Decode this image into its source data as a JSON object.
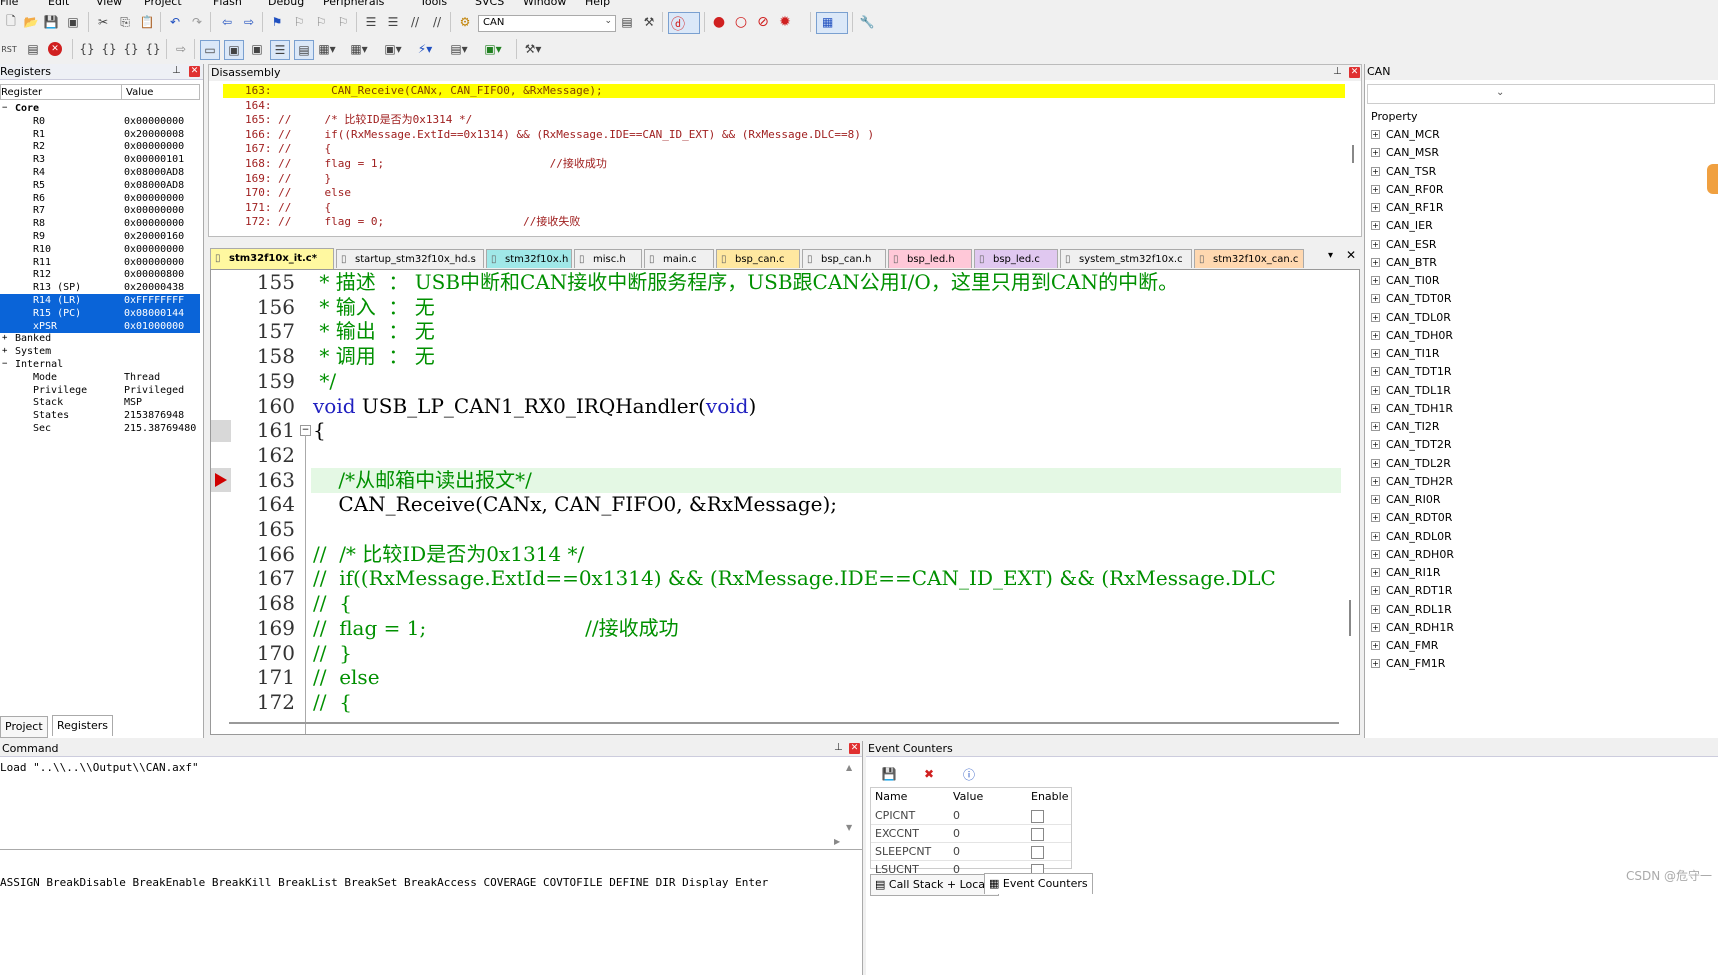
{
  "menu": [
    "File",
    "Edit",
    "View",
    "Project",
    "Flash",
    "Debug",
    "Peripherals",
    "Tools",
    "SVCS",
    "Window",
    "Help"
  ],
  "toolbar": {
    "target": "CAN"
  },
  "registers": {
    "title": "Registers",
    "col_register": "Register",
    "col_value": "Value",
    "core_label": "Core",
    "rows": [
      {
        "name": "R0",
        "value": "0x00000000"
      },
      {
        "name": "R1",
        "value": "0x20000008"
      },
      {
        "name": "R2",
        "value": "0x00000000"
      },
      {
        "name": "R3",
        "value": "0x00000101"
      },
      {
        "name": "R4",
        "value": "0x08000AD8"
      },
      {
        "name": "R5",
        "value": "0x08000AD8"
      },
      {
        "name": "R6",
        "value": "0x00000000"
      },
      {
        "name": "R7",
        "value": "0x00000000"
      },
      {
        "name": "R8",
        "value": "0x00000000"
      },
      {
        "name": "R9",
        "value": "0x20000160"
      },
      {
        "name": "R10",
        "value": "0x00000000"
      },
      {
        "name": "R11",
        "value": "0x00000000"
      },
      {
        "name": "R12",
        "value": "0x00000800"
      },
      {
        "name": "R13 (SP)",
        "value": "0x20000438"
      },
      {
        "name": "R14 (LR)",
        "value": "0xFFFFFFFF"
      },
      {
        "name": "R15 (PC)",
        "value": "0x08000144"
      },
      {
        "name": "xPSR",
        "value": "0x01000000"
      }
    ],
    "banked": "Banked",
    "system": "System",
    "internal": "Internal",
    "internal_rows": [
      {
        "name": "Mode",
        "value": "Thread"
      },
      {
        "name": "Privilege",
        "value": "Privileged"
      },
      {
        "name": "Stack",
        "value": "MSP"
      },
      {
        "name": "States",
        "value": "2153876948"
      },
      {
        "name": "Sec",
        "value": "215.38769480"
      }
    ],
    "tab_project": "Project",
    "tab_registers": "Registers"
  },
  "disassembly": {
    "title": "Disassembly",
    "lines": [
      "163:         CAN_Receive(CANx, CAN_FIFO0, &RxMessage);",
      "164: ",
      "165: //     /* 比较ID是否为0x1314 */",
      "166: //     if((RxMessage.ExtId==0x1314) && (RxMessage.IDE==CAN_ID_EXT) && (RxMessage.DLC==8) )",
      "167: //     {",
      "168: //     flag = 1;                         //接收成功",
      "169: //     }",
      "170: //     else",
      "171: //     {",
      "172: //     flag = 0;                     //接收失败"
    ]
  },
  "editor": {
    "tabs": [
      {
        "label": "stm32f10x_it.c*",
        "color": "#fff8a0"
      },
      {
        "label": "startup_stm32f10x_hd.s",
        "color": "#f0f0f0"
      },
      {
        "label": "stm32f10x.h",
        "color": "#a0e8e8"
      },
      {
        "label": "misc.h",
        "color": "#f0f0f0"
      },
      {
        "label": "main.c",
        "color": "#f0f0f0"
      },
      {
        "label": "bsp_can.c",
        "color": "#ffe8a0"
      },
      {
        "label": "bsp_can.h",
        "color": "#f0f0f0"
      },
      {
        "label": "bsp_led.h",
        "color": "#ffc8d8"
      },
      {
        "label": "bsp_led.c",
        "color": "#e0c8f0"
      },
      {
        "label": "system_stm32f10x.c",
        "color": "#f0f0f0"
      },
      {
        "label": "stm32f10x_can.c",
        "color": "#ffd8b0"
      }
    ],
    "line_numbers": [
      "155",
      "156",
      "157",
      "158",
      "159",
      "160",
      "161",
      "162",
      "163",
      "164",
      "165",
      "166",
      "167",
      "168",
      "169",
      "170",
      "171",
      "172"
    ],
    "code": [
      " * 描述  ： USB中断和CAN接收中断服务程序，USB跟CAN公用I/O，这里只用到CAN的中断。",
      " * 输入  ： 无",
      " * 输出  ： 无",
      " * 调用  ： 无",
      " */",
      "void USB_LP_CAN1_RX0_IRQHandler(void)",
      "{",
      "",
      "    /*从邮箱中读出报文*/",
      "    CAN_Receive(CANx, CAN_FIFO0, &RxMessage);",
      "",
      "//  /* 比较ID是否为0x1314 */",
      "//  if((RxMessage.ExtId==0x1314) && (RxMessage.IDE==CAN_ID_EXT) && (RxMessage.DLC",
      "//  {",
      "//  flag = 1;                         //接收成功",
      "//  }",
      "//  else",
      "//  {"
    ]
  },
  "can_panel": {
    "title": "CAN",
    "property_label": "Property",
    "items": [
      "CAN_MCR",
      "CAN_MSR",
      "CAN_TSR",
      "CAN_RF0R",
      "CAN_RF1R",
      "CAN_IER",
      "CAN_ESR",
      "CAN_BTR",
      "CAN_TI0R",
      "CAN_TDT0R",
      "CAN_TDL0R",
      "CAN_TDH0R",
      "CAN_TI1R",
      "CAN_TDT1R",
      "CAN_TDL1R",
      "CAN_TDH1R",
      "CAN_TI2R",
      "CAN_TDT2R",
      "CAN_TDL2R",
      "CAN_TDH2R",
      "CAN_RI0R",
      "CAN_RDT0R",
      "CAN_RDL0R",
      "CAN_RDH0R",
      "CAN_RI1R",
      "CAN_RDT1R",
      "CAN_RDL1R",
      "CAN_RDH1R",
      "CAN_FMR",
      "CAN_FM1R"
    ]
  },
  "command": {
    "title": "Command",
    "output": "Load \"..\\\\..\\\\Output\\\\CAN.axf\"",
    "hint": "ASSIGN BreakDisable BreakEnable BreakKill BreakList BreakSet BreakAccess COVERAGE COVTOFILE DEFINE DIR Display Enter"
  },
  "events": {
    "title": "Event Counters",
    "col_name": "Name",
    "col_value": "Value",
    "col_enable": "Enable",
    "rows": [
      {
        "name": "CPICNT",
        "value": "0"
      },
      {
        "name": "EXCCNT",
        "value": "0"
      },
      {
        "name": "SLEEPCNT",
        "value": "0"
      },
      {
        "name": "LSUCNT",
        "value": "0"
      }
    ],
    "tab_callstack": "Call Stack + Locals",
    "tab_events": "Event Counters"
  },
  "watermark": "CSDN @危守一"
}
